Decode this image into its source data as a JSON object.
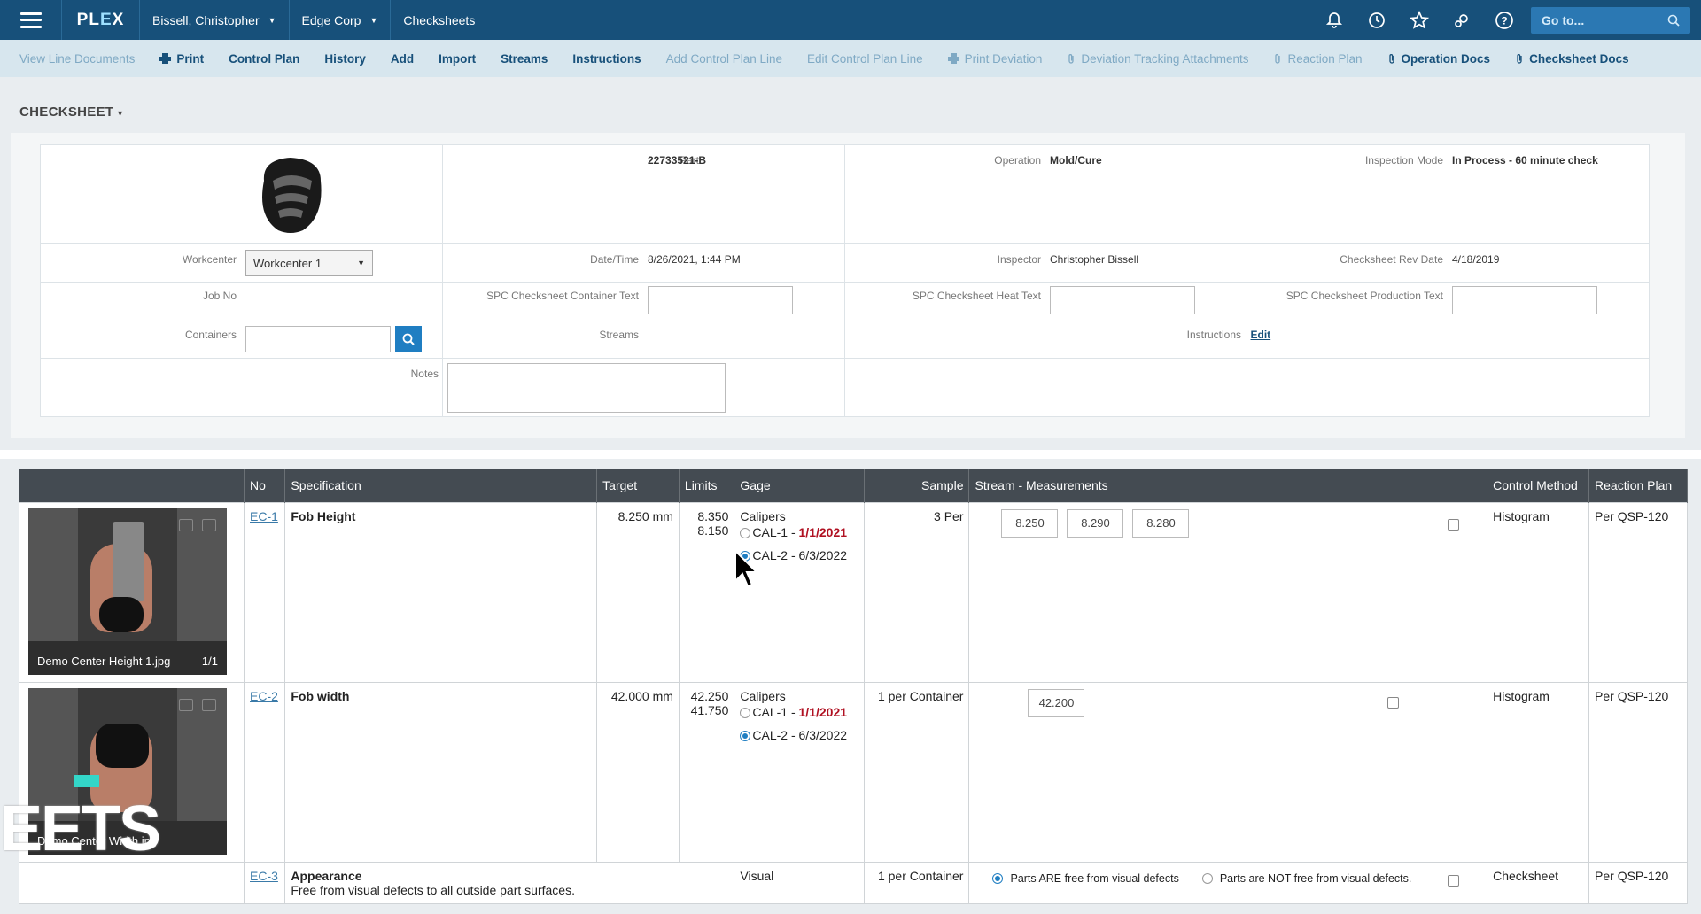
{
  "topbar": {
    "logo": "PLEX",
    "user": "Bissell, Christopher",
    "company": "Edge Corp",
    "title": "Checksheets",
    "goto_placeholder": "Go to..."
  },
  "actions": [
    {
      "label": "View Line Documents",
      "enabled": false,
      "icon": ""
    },
    {
      "label": "Print",
      "enabled": true,
      "icon": "print-icon"
    },
    {
      "label": "Control Plan",
      "enabled": true,
      "icon": ""
    },
    {
      "label": "History",
      "enabled": true,
      "icon": ""
    },
    {
      "label": "Add",
      "enabled": true,
      "icon": ""
    },
    {
      "label": "Import",
      "enabled": true,
      "icon": ""
    },
    {
      "label": "Streams",
      "enabled": true,
      "icon": ""
    },
    {
      "label": "Instructions",
      "enabled": true,
      "icon": ""
    },
    {
      "label": "Add Control Plan Line",
      "enabled": false,
      "icon": ""
    },
    {
      "label": "Edit Control Plan Line",
      "enabled": false,
      "icon": ""
    },
    {
      "label": "Print Deviation",
      "enabled": false,
      "icon": "print-icon"
    },
    {
      "label": "Deviation Tracking Attachments",
      "enabled": false,
      "icon": "paperclip-icon"
    },
    {
      "label": "Reaction Plan",
      "enabled": false,
      "icon": "paperclip-icon"
    },
    {
      "label": "Operation Docs",
      "enabled": true,
      "icon": "paperclip-icon"
    },
    {
      "label": "Checksheet Docs",
      "enabled": true,
      "icon": "paperclip-icon"
    }
  ],
  "checksheet": {
    "title": "CHECKSHEET",
    "part_label": "Part",
    "part": "22733521-B",
    "operation_label": "Operation",
    "operation": "Mold/Cure",
    "inspection_mode_label": "Inspection Mode",
    "inspection_mode": "In Process - 60 minute check",
    "workcenter_label": "Workcenter",
    "workcenter": "Workcenter 1",
    "datetime_label": "Date/Time",
    "datetime": "8/26/2021, 1:44 PM",
    "inspector_label": "Inspector",
    "inspector": "Christopher Bissell",
    "rev_date_label": "Checksheet Rev Date",
    "rev_date": "4/18/2019",
    "job_no_label": "Job No",
    "container_text_label": "SPC Checksheet Container Text",
    "heat_text_label": "SPC Checksheet Heat Text",
    "production_text_label": "SPC Checksheet Production Text",
    "containers_label": "Containers",
    "streams_label": "Streams",
    "instructions_label": "Instructions",
    "instructions_link": "Edit",
    "notes_label": "Notes"
  },
  "grid": {
    "headers": [
      "",
      "No",
      "Specification",
      "Target",
      "Limits",
      "Gage",
      "Sample",
      "Stream - Measurements",
      "",
      "Control Method",
      "Reaction Plan"
    ],
    "rows": [
      {
        "image_caption": "Demo Center Height 1.jpg",
        "image_count": "1/1",
        "no": "EC-1",
        "spec": "Fob Height",
        "target": "8.250 mm",
        "limit_hi": "8.350",
        "limit_lo": "8.150",
        "gage": "Calipers",
        "gage_opt1": "CAL-1 - ",
        "gage_opt1_date": "1/1/2021",
        "gage_opt2": "CAL-2 - 6/3/2022",
        "sample": "3 Per",
        "measurements": [
          "8.250",
          "8.290",
          "8.280"
        ],
        "control": "Histogram",
        "reaction": "Per QSP-120"
      },
      {
        "image_caption": "Demo Center Width.jpg",
        "image_count": "",
        "no": "EC-2",
        "spec": "Fob width",
        "target": "42.000 mm",
        "limit_hi": "42.250",
        "limit_lo": "41.750",
        "gage": "Calipers",
        "gage_opt1": "CAL-1 - ",
        "gage_opt1_date": "1/1/2021",
        "gage_opt2": "CAL-2 - 6/3/2022",
        "sample": "1 per Container",
        "measurements": [
          "42.200"
        ],
        "control": "Histogram",
        "reaction": "Per QSP-120"
      },
      {
        "no": "EC-3",
        "spec": "Appearance",
        "spec_desc": "Free from visual defects to all outside part surfaces.",
        "gage": "Visual",
        "sample": "1 per Container",
        "opt_yes": "Parts ARE free from visual defects",
        "opt_no": "Parts are NOT free from visual defects.",
        "control": "Checksheet",
        "reaction": "Per QSP-120"
      }
    ]
  },
  "overlay_text": "EETS",
  "colors": {
    "topbar": "#17507a",
    "actionbar": "#d7e6ee",
    "link": "#17507a",
    "red": "#b01021"
  }
}
